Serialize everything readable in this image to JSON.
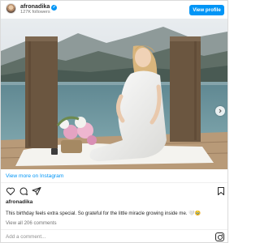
{
  "header": {
    "username": "afronadika",
    "followers": "127K followers",
    "verified_badge": "✓",
    "view_profile_label": "View profile"
  },
  "photo": {
    "next_arrow_icon": "chevron-right-icon"
  },
  "link": {
    "view_more_label": "View more on Instagram"
  },
  "actions": {
    "icons": [
      "heart-icon",
      "comment-icon",
      "share-icon",
      "bookmark-icon"
    ]
  },
  "post": {
    "author": "afronadika",
    "caption": "This birthday feels extra special. So grateful for the little miracle growing inside me. 🤍🥹",
    "view_comments": "View all 206 comments"
  },
  "comment": {
    "placeholder": "Add a comment..."
  },
  "colors": {
    "accent": "#0095f6",
    "text": "#262626",
    "muted": "#737373"
  }
}
